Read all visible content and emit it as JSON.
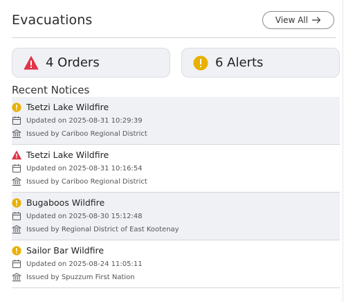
{
  "header": {
    "title": "Evacuations",
    "view_all_label": "View All"
  },
  "stats": {
    "orders_label": "4 Orders",
    "alerts_label": "6 Alerts"
  },
  "colors": {
    "order_red": "#e0354a",
    "alert_yellow": "#e8b100",
    "row_shade": "#f0f1f5"
  },
  "recent": {
    "title": "Recent Notices",
    "items": [
      {
        "severity": "alert",
        "name": "Tsetzi Lake Wildfire",
        "updated": "Updated on 2025-08-31 10:29:39",
        "issuer": "Issued by Cariboo Regional District"
      },
      {
        "severity": "order",
        "name": "Tsetzi Lake Wildfire",
        "updated": "Updated on 2025-08-31 10:16:54",
        "issuer": "Issued by Cariboo Regional District"
      },
      {
        "severity": "alert",
        "name": "Bugaboos Wildfire",
        "updated": "Updated on 2025-08-30 15:12:48",
        "issuer": "Issued by Regional District of East Kootenay"
      },
      {
        "severity": "alert",
        "name": "Sailor Bar Wildfire",
        "updated": "Updated on 2025-08-24 11:05:11",
        "issuer": "Issued by Spuzzum First Nation"
      }
    ]
  }
}
